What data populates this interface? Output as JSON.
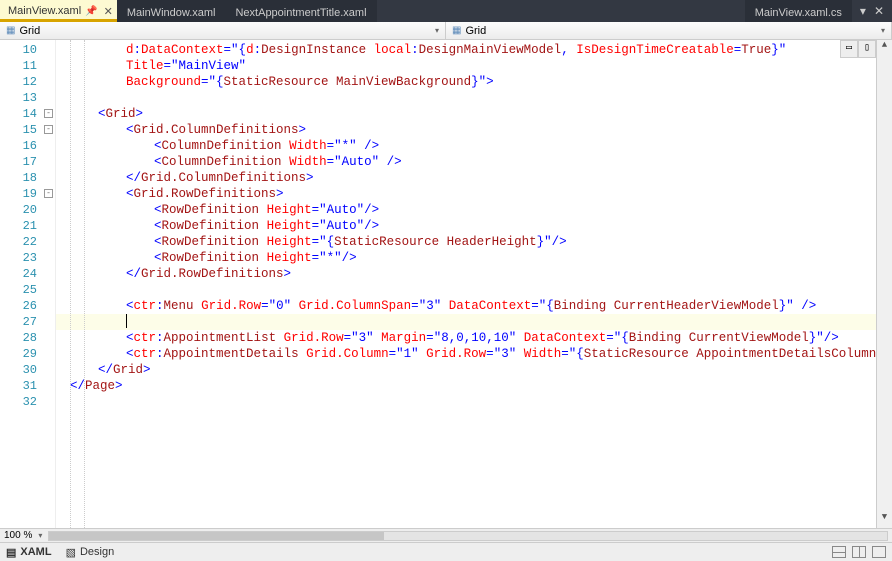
{
  "tabs": {
    "active": "MainView.xaml",
    "items": [
      "MainView.xaml",
      "MainWindow.xaml",
      "NextAppointmentTitle.xaml"
    ],
    "right": "MainView.xaml.cs"
  },
  "crumbs": {
    "left": "Grid",
    "right": "Grid"
  },
  "zoom": "100 %",
  "bottom": {
    "xaml": "XAML",
    "design": "Design"
  },
  "line_start": 10,
  "lines": [
    {
      "indent": 8,
      "html": "<span class='a'>d</span><span class='p'>:</span><span class='a'>DataContext</span><span class='p'>=\"{</span><span class='a'>d</span><span class='p'>:</span><span class='m'>DesignInstance </span><span class='a'>local</span><span class='p'>:</span><span class='m'>DesignMainViewModel</span><span class='p'>, </span><span class='a'>IsDesignTimeCreatable</span><span class='p'>=</span><span class='m'>True</span><span class='p'>}\"</span>"
    },
    {
      "indent": 8,
      "html": "<span class='a'>Title</span><span class='p'>=</span><span class='s'>\"MainView\"</span>"
    },
    {
      "indent": 8,
      "html": "<span class='a'>Background</span><span class='p'>=\"{</span><span class='m'>StaticResource MainViewBackground</span><span class='p'>}\"&gt;</span>"
    },
    {
      "indent": 0,
      "html": ""
    },
    {
      "indent": 4,
      "html": "<span class='p'>&lt;</span><span class='t'>Grid</span><span class='p'>&gt;</span>",
      "mark": "-"
    },
    {
      "indent": 8,
      "html": "<span class='p'>&lt;</span><span class='t'>Grid.ColumnDefinitions</span><span class='p'>&gt;</span>",
      "mark": "-"
    },
    {
      "indent": 12,
      "html": "<span class='p'>&lt;</span><span class='t'>ColumnDefinition</span> <span class='a'>Width</span><span class='p'>=</span><span class='s'>\"*\"</span> <span class='p'>/&gt;</span>"
    },
    {
      "indent": 12,
      "html": "<span class='p'>&lt;</span><span class='t'>ColumnDefinition</span> <span class='a'>Width</span><span class='p'>=</span><span class='s'>\"Auto\"</span> <span class='p'>/&gt;</span>"
    },
    {
      "indent": 8,
      "html": "<span class='p'>&lt;/</span><span class='t'>Grid.ColumnDefinitions</span><span class='p'>&gt;</span>"
    },
    {
      "indent": 8,
      "html": "<span class='p'>&lt;</span><span class='t'>Grid.RowDefinitions</span><span class='p'>&gt;</span>",
      "mark": "-"
    },
    {
      "indent": 12,
      "html": "<span class='p'>&lt;</span><span class='t'>RowDefinition</span> <span class='a'>Height</span><span class='p'>=</span><span class='s'>\"Auto\"</span><span class='p'>/&gt;</span>"
    },
    {
      "indent": 12,
      "html": "<span class='p'>&lt;</span><span class='t'>RowDefinition</span> <span class='a'>Height</span><span class='p'>=</span><span class='s'>\"Auto\"</span><span class='p'>/&gt;</span>"
    },
    {
      "indent": 12,
      "html": "<span class='p'>&lt;</span><span class='t'>RowDefinition</span> <span class='a'>Height</span><span class='p'>=\"{</span><span class='m'>StaticResource HeaderHeight</span><span class='p'>}\"/&gt;</span>"
    },
    {
      "indent": 12,
      "html": "<span class='p'>&lt;</span><span class='t'>RowDefinition</span> <span class='a'>Height</span><span class='p'>=</span><span class='s'>\"*\"</span><span class='p'>/&gt;</span>"
    },
    {
      "indent": 8,
      "html": "<span class='p'>&lt;/</span><span class='t'>Grid.RowDefinitions</span><span class='p'>&gt;</span>"
    },
    {
      "indent": 0,
      "html": ""
    },
    {
      "indent": 8,
      "html": "<span class='p'>&lt;</span><span class='a'>ctr</span><span class='p'>:</span><span class='t'>Menu</span> <span class='a'>Grid.Row</span><span class='p'>=</span><span class='s'>\"0\"</span> <span class='a'>Grid.ColumnSpan</span><span class='p'>=</span><span class='s'>\"3\"</span> <span class='a'>DataContext</span><span class='p'>=\"{</span><span class='m'>Binding CurrentHeaderViewModel</span><span class='p'>}\" /&gt;</span>"
    },
    {
      "indent": 8,
      "html": "<span class='cursor'></span>",
      "current": true
    },
    {
      "indent": 8,
      "html": "<span class='p'>&lt;</span><span class='a'>ctr</span><span class='p'>:</span><span class='t'>AppointmentList</span> <span class='a'>Grid.Row</span><span class='p'>=</span><span class='s'>\"3\"</span> <span class='a'>Margin</span><span class='p'>=</span><span class='s'>\"8,0,10,10\"</span> <span class='a'>DataContext</span><span class='p'>=\"{</span><span class='m'>Binding CurrentViewModel</span><span class='p'>}\"/&gt;</span>"
    },
    {
      "indent": 8,
      "html": "<span class='p'>&lt;</span><span class='a'>ctr</span><span class='p'>:</span><span class='t'>AppointmentDetails</span> <span class='a'>Grid.Column</span><span class='p'>=</span><span class='s'>\"1\"</span> <span class='a'>Grid.Row</span><span class='p'>=</span><span class='s'>\"3\"</span> <span class='a'>Width</span><span class='p'>=\"{</span><span class='m'>StaticResource AppointmentDetailsColumnW</span>"
    },
    {
      "indent": 4,
      "html": "<span class='p'>&lt;/</span><span class='t'>Grid</span><span class='p'>&gt;</span>"
    },
    {
      "indent": 0,
      "html": "<span class='p'>&lt;/</span><span class='t'>Page</span><span class='p'>&gt;</span>"
    },
    {
      "indent": 0,
      "html": ""
    }
  ]
}
